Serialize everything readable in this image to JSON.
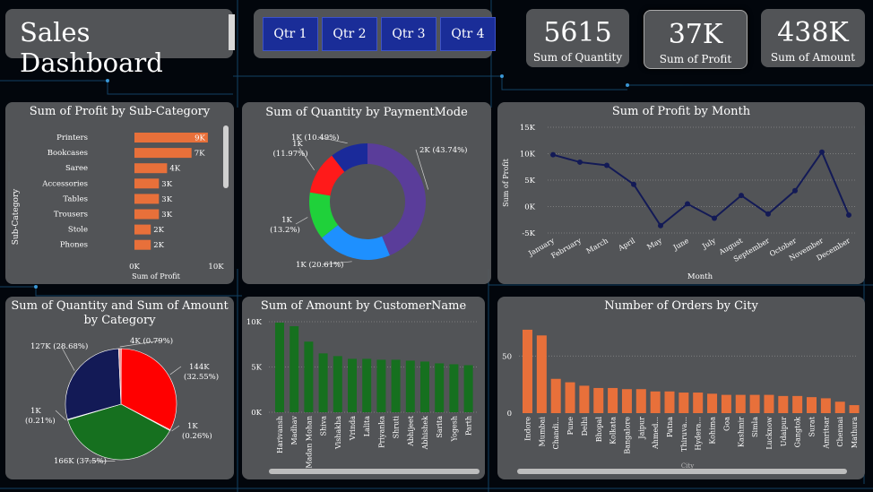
{
  "header": {
    "title": "Sales Dashboard"
  },
  "slicer": {
    "buttons": [
      "Qtr 1",
      "Qtr 2",
      "Qtr 3",
      "Qtr 4"
    ]
  },
  "kpis": {
    "quantity": {
      "value": "5615",
      "label": "Sum of Quantity"
    },
    "profit": {
      "value": "37K",
      "label": "Sum of Profit"
    },
    "amount": {
      "value": "438K",
      "label": "Sum of Amount"
    }
  },
  "colors": {
    "orange": "#e8703a",
    "green": "#16701f",
    "navy": "#131a56",
    "purple": "#5a3d9a",
    "blue": "#1e90ff",
    "lime": "#1fd13a",
    "red": "#ff1a1a",
    "darkblue": "#1a2a9a"
  },
  "chart_data": [
    {
      "id": "profit_by_subcategory",
      "type": "bar",
      "orientation": "horizontal",
      "title": "Sum of Profit by Sub-Category",
      "xlabel": "Sum of Profit",
      "ylabel": "Sub-Category",
      "categories": [
        "Printers",
        "Bookcases",
        "Saree",
        "Accessories",
        "Tables",
        "Trousers",
        "Stole",
        "Phones"
      ],
      "values": [
        9000,
        7000,
        4000,
        3000,
        3000,
        3000,
        2000,
        2000
      ],
      "data_labels": [
        "9K",
        "7K",
        "4K",
        "3K",
        "3K",
        "3K",
        "2K",
        "2K"
      ],
      "xticks": [
        "0K",
        "10K"
      ],
      "xlim": [
        0,
        10000
      ]
    },
    {
      "id": "quantity_by_paymentmode",
      "type": "pie",
      "donut": true,
      "title": "Sum of Quantity by PaymentMode",
      "values": [
        43.74,
        20.61,
        13.2,
        11.97,
        10.49
      ],
      "labels": [
        "2K (43.74%)",
        "1K (20.61%)",
        "1K (13.2%)",
        "1K (11.97%)",
        "1K (10.49%)"
      ],
      "colors": [
        "#5a3d9a",
        "#1e90ff",
        "#1fd13a",
        "#ff1a1a",
        "#1a2a9a"
      ]
    },
    {
      "id": "profit_by_month",
      "type": "line",
      "title": "Sum of Profit by Month",
      "xlabel": "Month",
      "ylabel": "Sum of Profit",
      "categories": [
        "January",
        "February",
        "March",
        "April",
        "May",
        "June",
        "July",
        "August",
        "September",
        "October",
        "November",
        "December"
      ],
      "values": [
        9800,
        8400,
        7800,
        4200,
        -3600,
        500,
        -2200,
        2100,
        -1400,
        3000,
        10300,
        -1600
      ],
      "yticks": [
        "15K",
        "10K",
        "5K",
        "0K",
        "-5K"
      ],
      "ylim": [
        -5000,
        15000
      ]
    },
    {
      "id": "quantity_amount_by_category",
      "type": "pie",
      "title": "Sum of Quantity and Sum of Amount by Category",
      "values": [
        32.55,
        0.26,
        37.5,
        0.21,
        28.68,
        0.79
      ],
      "labels": [
        "144K (32.55%)",
        "1K (0.26%)",
        "166K (37.5%)",
        "1K (0.21%)",
        "127K (28.68%)",
        "4K (0.79%)"
      ],
      "colors": [
        "#ff0000",
        "#ff8080",
        "#16701f",
        "#7fbf7f",
        "#131a56",
        "#e8a0a0"
      ]
    },
    {
      "id": "amount_by_customername",
      "type": "bar",
      "title": "Sum of Amount by CustomerName",
      "categories": [
        "Harivansh",
        "Madhav",
        "Madan Mohan",
        "Shiva",
        "Vishakha",
        "Vrinda",
        "Lalita",
        "Priyanka",
        "Shruti",
        "Abhijeet",
        "Abhishek",
        "Sarita",
        "Yogesh",
        "Parth"
      ],
      "values": [
        9900,
        9500,
        7800,
        6500,
        6200,
        5900,
        5900,
        5800,
        5800,
        5700,
        5600,
        5400,
        5300,
        5200
      ],
      "yticks": [
        "10K",
        "5K",
        "0K"
      ],
      "ylim": [
        0,
        10000
      ]
    },
    {
      "id": "orders_by_city",
      "type": "bar",
      "title": "Number of Orders by City",
      "xlabel": "City",
      "categories": [
        "Indore",
        "Mumbai",
        "Chandi...",
        "Pune",
        "Delhi",
        "Bhopal",
        "Kolkata",
        "Bangalore",
        "Jaipur",
        "Ahmed...",
        "Patna",
        "Thiruva...",
        "Hydera...",
        "Kohima",
        "Goa",
        "Kashmir",
        "Simla",
        "Lucknow",
        "Udaipur",
        "Gangtok",
        "Surat",
        "Amritsar",
        "Chennai",
        "Mathura"
      ],
      "values": [
        73,
        68,
        30,
        27,
        24,
        22,
        22,
        21,
        21,
        19,
        19,
        18,
        18,
        17,
        16,
        16,
        16,
        16,
        15,
        15,
        14,
        13,
        10,
        7
      ],
      "yticks": [
        "50",
        "0"
      ],
      "ylim": [
        0,
        80
      ]
    }
  ]
}
